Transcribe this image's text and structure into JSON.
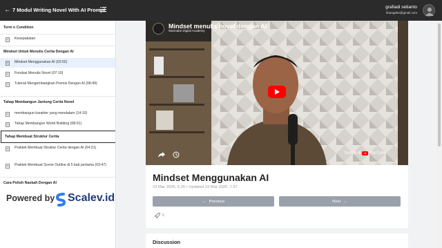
{
  "header": {
    "back_icon": "arrow-left-icon",
    "course_title": "7 Modul Writing Novel With AI Prompt",
    "menu_icon": "list-icon",
    "user_name": "grafiadi setianto",
    "user_email": "khangahe@gmail.com"
  },
  "sidebar": {
    "sections": [
      {
        "title": "Term n Condition",
        "items": [
          {
            "label": "Kesepakatan"
          }
        ]
      },
      {
        "title": "Mindset Untuk Menulis Cerita Dengan AI",
        "items": [
          {
            "label": "Mindset Menggunakan AI (02:02)",
            "active": true
          },
          {
            "label": "Fondasi Menulis Novel (07:10)"
          },
          {
            "label": "Tutorial Mengembangkan Premis Dengan AI (08:49)"
          }
        ]
      },
      {
        "title": "Tahap Membangun Jantung Cerita Novel",
        "items": [
          {
            "label": "membangun karakter yang mendalam (14:10)"
          },
          {
            "label": "Tahap Membangun World Building (08:01)"
          }
        ]
      },
      {
        "title": "Tahap Membuat Struktur Cerita",
        "items": [
          {
            "label": "Praktek Membuat Struktur Cerita dengan AI (04:21)"
          },
          {
            "label": "Praktek Membuat Scene Outline di 5 bab pertama (03:47)"
          }
        ]
      },
      {
        "title": "Cara Polish Naskah Dengan AI",
        "items": []
      }
    ],
    "powered_by": "Powered by",
    "brand": "Scalev.id"
  },
  "video": {
    "title": "Mindset menulis novel dengan AI",
    "channel": "Wannabe Digital Academy",
    "watch_on": "Tonton di",
    "platform": "YouTube"
  },
  "lesson": {
    "title": "Mindset Menggunakan AI",
    "meta": "23 Mar 2026, 6.25  •  Updated 23 Mar 2026, 7.57",
    "prev_label": "Previous",
    "next_label": "Next",
    "reaction_count": "0"
  },
  "discussion": {
    "title": "Discussion"
  },
  "colors": {
    "topbar": "#2b2b2b",
    "active_item": "#e8f1fb",
    "button": "#9aa1ab",
    "brand": "#1f3a7a",
    "youtube": "#ff0000"
  }
}
